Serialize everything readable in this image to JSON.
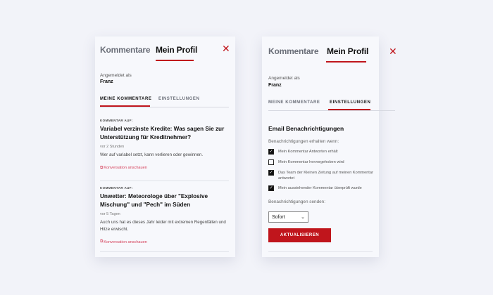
{
  "left": {
    "tabs": [
      "Kommentare",
      "Mein Profil"
    ],
    "logged_in_label": "Angemeldet als",
    "username": "Franz",
    "subtabs": [
      "MEINE KOMMENTARE",
      "EINSTELLUNGEN"
    ],
    "comments": [
      {
        "kicker": "KOMMENTAR AUF:",
        "title": "Variabel verzinste Kredite: Was sagen Sie zur Unterstützung für Kreditnehmer?",
        "time": "vor 2 Stunden",
        "text": "Wer auf variabel setzt, kann verlieren oder gewinnen.",
        "link": "Konversation anschauen"
      },
      {
        "kicker": "KOMMENTAR AUF:",
        "title": "Unwetter: Meteorologe über \"Explosive Mischung\" und \"Pech\" im Süden",
        "time": "vor 5 Tagen",
        "text": "Auch uns hat es dieses Jahr leider mit extremen Regenfällen und Hitze erwischt.",
        "link": "Konversation anschauen"
      }
    ]
  },
  "right": {
    "tabs": [
      "Kommentare",
      "Mein Profil"
    ],
    "logged_in_label": "Angemeldet als",
    "username": "Franz",
    "subtabs": [
      "MEINE KOMMENTARE",
      "EINSTELLUNGEN"
    ],
    "section_title": "Email Benachrichtigungen",
    "receive_label": "Benachrichtigungen erhalten wenn:",
    "options": [
      {
        "label": "Mein Kommentar Antworten erhält",
        "checked": true
      },
      {
        "label": "Mein Kommentar hervorgehoben wird",
        "checked": false
      },
      {
        "label": "Das Team der Kleinen Zeitung auf meinen Kommentar antwortet",
        "checked": true
      },
      {
        "label": "Mein ausstehender Kommentar überprüft wurde",
        "checked": true
      }
    ],
    "send_label": "Benachrichtigungen senden:",
    "send_value": "Sofort",
    "update_button": "AKTUALISIEREN"
  },
  "colors": {
    "accent": "#c0151c",
    "link": "#d5405a",
    "background": "#f2f3f9",
    "panel": "#f7f8fc"
  },
  "icons": {
    "close": "close-icon",
    "link": "external-link-icon",
    "dropdown": "chevron-down-icon",
    "check": "checkmark-icon"
  }
}
